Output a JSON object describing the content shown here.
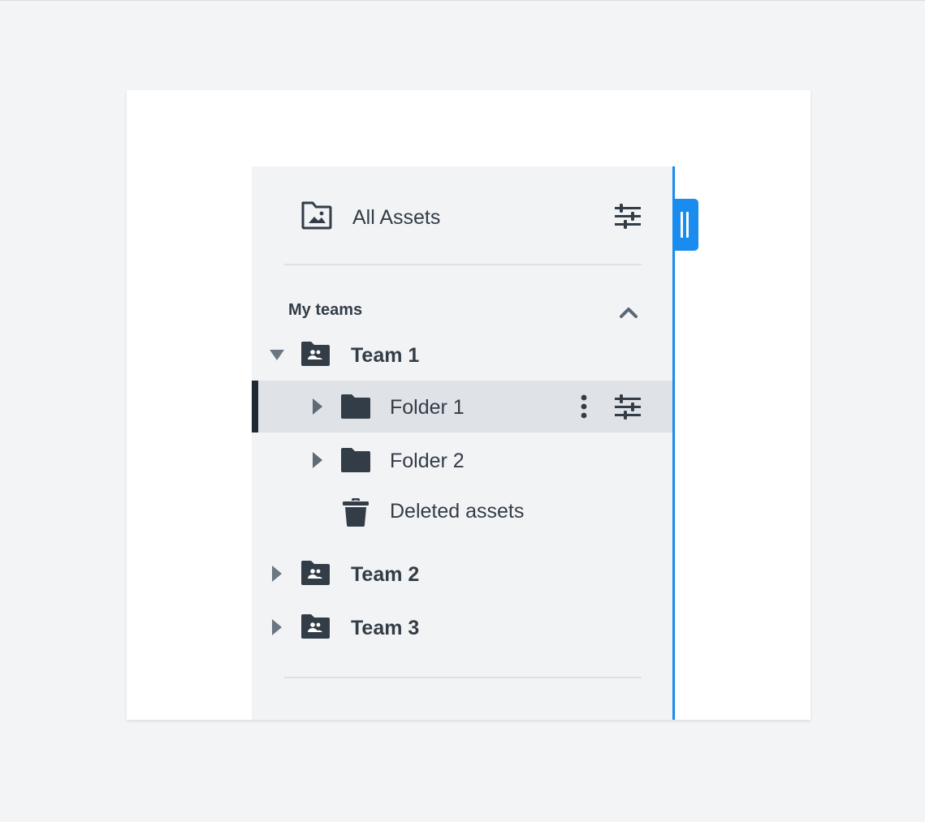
{
  "sidebar": {
    "all_assets_label": "All Assets",
    "section_title": "My teams",
    "teams": [
      {
        "label": "Team 1",
        "expanded": true
      },
      {
        "label": "Team 2",
        "expanded": false
      },
      {
        "label": "Team 3",
        "expanded": false
      }
    ],
    "folders": [
      {
        "label": "Folder 1",
        "selected": true
      },
      {
        "label": "Folder 2",
        "selected": false
      }
    ],
    "deleted_label": "Deleted assets"
  },
  "colors": {
    "accent": "#1a8cf0",
    "text": "#333d47",
    "panel_bg": "#f2f3f5",
    "selected_bg": "#dfe2e6"
  },
  "icons": {
    "all_assets": "image-folder-icon",
    "filter": "sliders-icon",
    "collapse": "chevron-up-icon",
    "team": "team-folder-icon",
    "folder": "folder-icon",
    "more": "more-vertical-icon",
    "trash": "trash-icon",
    "expand": "caret-right-icon",
    "expanded": "caret-down-icon"
  }
}
